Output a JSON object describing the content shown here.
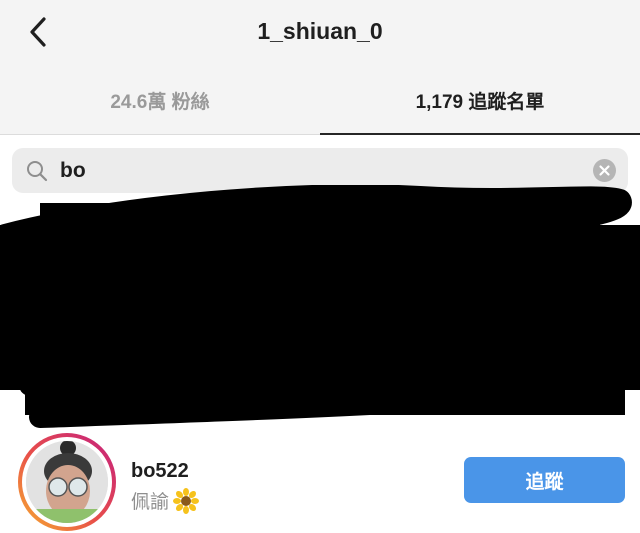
{
  "header": {
    "title": "1_shiuan_0",
    "back_icon": "chevron-left-icon"
  },
  "tabs": [
    {
      "label": "24.6萬 粉絲",
      "active": false
    },
    {
      "label": "1,179 追蹤名單",
      "active": true
    }
  ],
  "search": {
    "value": "bo",
    "icon": "search-icon",
    "clear_icon": "clear-icon"
  },
  "result": {
    "username": "bo522",
    "full_name": "佩諭",
    "name_emoji": "sunflower-icon",
    "follow_label": "追蹤"
  },
  "colors": {
    "follow_button": "#4a95e8",
    "story_ring_start": "#f7b12f",
    "story_ring_end": "#c41f7f"
  }
}
